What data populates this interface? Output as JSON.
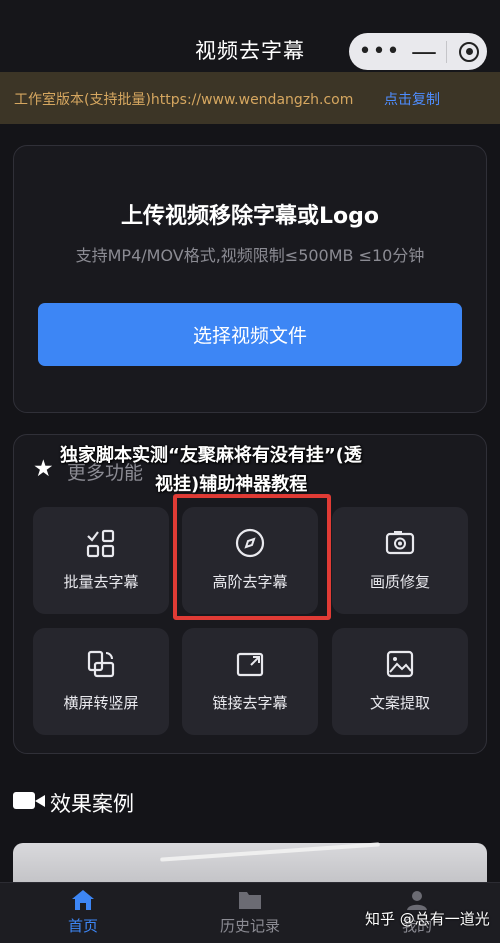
{
  "header": {
    "title": "视频去字幕",
    "more_glyph": "•••",
    "minus_glyph": "—"
  },
  "notice": {
    "text": "工作室版本(支持批量)https://www.wendangzh.com",
    "link": "点击复制"
  },
  "upload": {
    "title": "上传视频移除字幕或Logo",
    "subtitle": "支持MP4/MOV格式,视频限制≤500MB ≤10分钟",
    "button": "选择视频文件"
  },
  "more_features": {
    "title": "更多功能",
    "tiles": [
      {
        "label": "批量去字幕",
        "icon": "batch-icon"
      },
      {
        "label": "高阶去字幕",
        "icon": "compass-icon",
        "highlighted": true
      },
      {
        "label": "画质修复",
        "icon": "camera-enhance-icon"
      },
      {
        "label": "横屏转竖屏",
        "icon": "rotate-screen-icon"
      },
      {
        "label": "链接去字幕",
        "icon": "link-expand-icon"
      },
      {
        "label": "文案提取",
        "icon": "image-text-icon"
      }
    ]
  },
  "overlay_caption": {
    "line1": "独家脚本实测“友聚麻将有没有挂”(透",
    "line2": "视挂)辅助神器教程"
  },
  "cases": {
    "title": "效果案例"
  },
  "tabbar": {
    "items": [
      {
        "label": "首页",
        "icon": "home-icon",
        "active": true
      },
      {
        "label": "历史记录",
        "icon": "folder-icon",
        "active": false
      },
      {
        "label": "我的",
        "icon": "user-icon",
        "active": false
      }
    ]
  },
  "watermark": "知乎 @总有一道光",
  "colors": {
    "accent": "#3d86f5",
    "notice_text": "#d6a760",
    "highlight_border": "#e03b35"
  }
}
